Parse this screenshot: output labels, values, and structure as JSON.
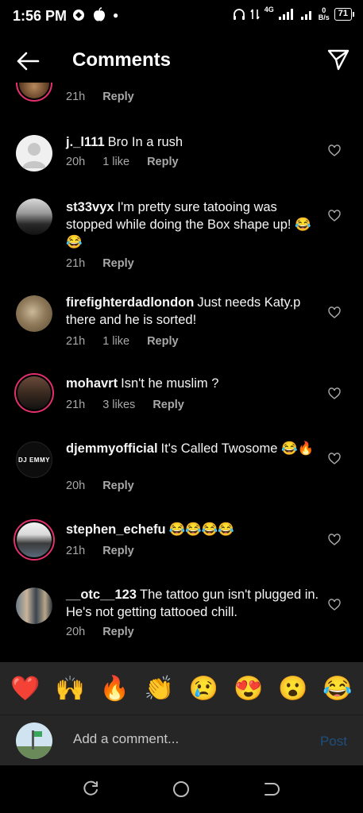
{
  "status": {
    "time": "1:56 PM",
    "network": "4G",
    "speed_value": "0",
    "speed_unit": "B/s",
    "battery": "71"
  },
  "header": {
    "title": "Comments"
  },
  "partial_comment": {
    "time": "21h",
    "reply": "Reply"
  },
  "comments": [
    {
      "user": "j._l111",
      "text": "Bro In a rush",
      "time": "20h",
      "likes": "1 like",
      "reply": "Reply",
      "avatar": "default"
    },
    {
      "user": "st33vyx",
      "text": "I'm pretty sure tatooing was stopped while doing the Box shape up! 😂😂",
      "time": "21h",
      "likes": "",
      "reply": "Reply",
      "avatar": "photo"
    },
    {
      "user": "firefighterdadlondon",
      "text": "Just needs Katy.p there and he is sorted!",
      "time": "21h",
      "likes": "1 like",
      "reply": "Reply",
      "avatar": "photo"
    },
    {
      "user": "mohavrt",
      "text": "Isn't he muslim ?",
      "time": "21h",
      "likes": "3 likes",
      "reply": "Reply",
      "avatar": "story"
    },
    {
      "user": "djemmyofficial",
      "text": "It's Called Twosome 😂🔥",
      "time": "20h",
      "likes": "",
      "reply": "Reply",
      "avatar": "logo",
      "avatar_text": "DJ EMMY"
    },
    {
      "user": "stephen_echefu",
      "text": "😂😂😂😂",
      "time": "21h",
      "likes": "",
      "reply": "Reply",
      "avatar": "story"
    },
    {
      "user": "__otc__123",
      "text": "The tattoo gun isn't plugged in. He's not getting tattooed chill.",
      "time": "20h",
      "likes": "",
      "reply": "Reply",
      "avatar": "photo"
    }
  ],
  "emoji_bar": [
    "❤️",
    "🙌",
    "🔥",
    "👏",
    "😢",
    "😍",
    "😮",
    "😂"
  ],
  "composer": {
    "placeholder": "Add a comment...",
    "post": "Post"
  },
  "colors": {
    "background": "#000000",
    "story_ring": "#e1306c",
    "muted_text": "#a8a8a8",
    "post_disabled": "#1e4f7d",
    "panel": "#262626"
  }
}
